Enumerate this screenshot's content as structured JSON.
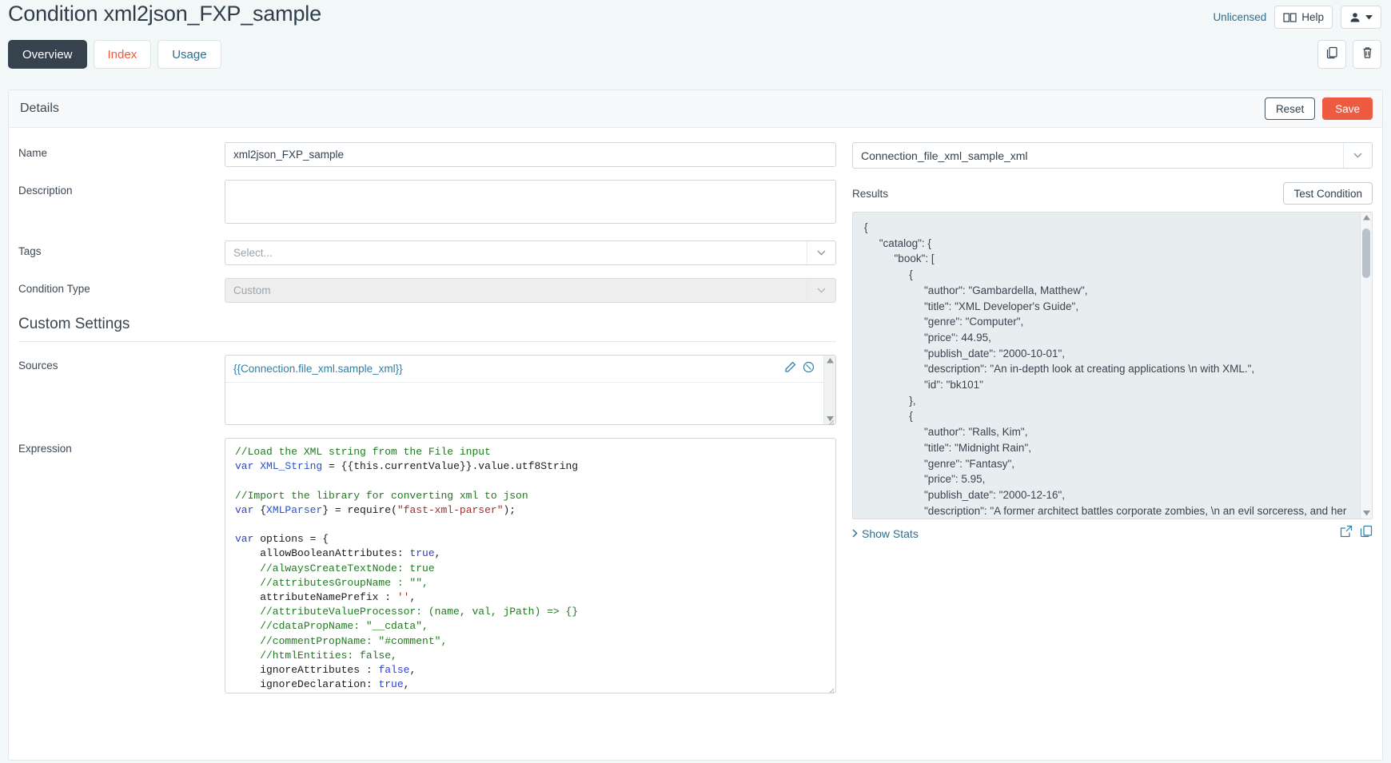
{
  "header": {
    "title": "Condition xml2json_FXP_sample",
    "unlicensed_label": "Unlicensed",
    "help_label": "Help"
  },
  "tabs": [
    {
      "label": "Overview",
      "state": "active"
    },
    {
      "label": "Index",
      "state": "warn"
    },
    {
      "label": "Usage",
      "state": "link"
    }
  ],
  "details": {
    "panel_title": "Details",
    "reset_label": "Reset",
    "save_label": "Save",
    "fields": {
      "name_label": "Name",
      "name_value": "xml2json_FXP_sample",
      "description_label": "Description",
      "description_value": "",
      "tags_label": "Tags",
      "tags_placeholder": "Select...",
      "condition_type_label": "Condition Type",
      "condition_type_value": "Custom"
    }
  },
  "custom_settings": {
    "section_title": "Custom Settings",
    "sources_label": "Sources",
    "sources_token": "{{Connection.file_xml.sample_xml}}",
    "expression_label": "Expression",
    "expression_code": "//Load the XML string from the File input\nvar XML_String = {{this.currentValue}}.value.utf8String\n\n//Import the library for converting xml to json\nvar {XMLParser} = require(\"fast-xml-parser\");\n\nvar options = {\n    allowBooleanAttributes: true,\n    //alwaysCreateTextNode: true\n    //attributesGroupName : \"\",\n    attributeNamePrefix : '',\n    //attributeValueProcessor: (name, val, jPath) => {}\n    //cdataPropName: \"__cdata\",\n    //commentPropName: \"#comment\",\n    //htmlEntities: false,\n    ignoreAttributes : false,\n    ignoreDeclaration: true,\n    ignorePiTags: true"
  },
  "right": {
    "connection_value": "Connection_file_xml_sample_xml",
    "results_label": "Results",
    "test_condition_label": "Test Condition",
    "show_stats_label": "Show Stats",
    "results_json": "{\n     \"catalog\": {\n          \"book\": [\n               {\n                    \"author\": \"Gambardella, Matthew\",\n                    \"title\": \"XML Developer's Guide\",\n                    \"genre\": \"Computer\",\n                    \"price\": 44.95,\n                    \"publish_date\": \"2000-10-01\",\n                    \"description\": \"An in-depth look at creating applications \\n with XML.\",\n                    \"id\": \"bk101\"\n               },\n               {\n                    \"author\": \"Ralls, Kim\",\n                    \"title\": \"Midnight Rain\",\n                    \"genre\": \"Fantasy\",\n                    \"price\": 5.95,\n                    \"publish_date\": \"2000-12-16\",\n                    \"description\": \"A former architect battles corporate zombies, \\n an evil sorceress, and her own childhood to become"
  },
  "colors": {
    "accent_save": "#ef5b40",
    "tab_active_bg": "#36424e",
    "link": "#2e6e8e",
    "page_bg": "#f2f7f7"
  }
}
